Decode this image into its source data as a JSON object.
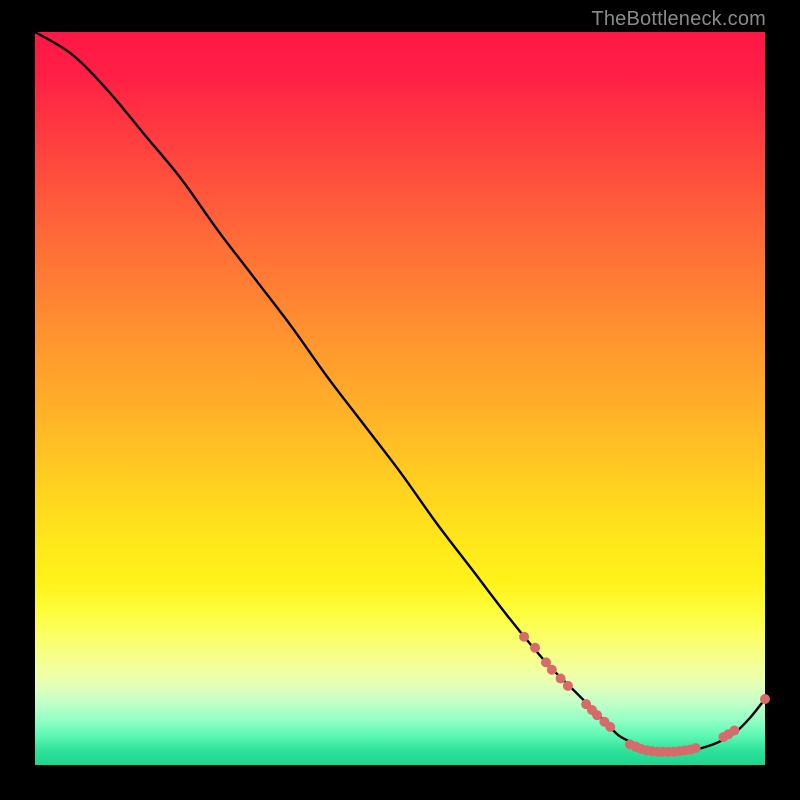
{
  "watermark": "TheBottleneck.com",
  "colors": {
    "marker": "#d76a6a",
    "curve": "#000000"
  },
  "chart_data": {
    "type": "line",
    "title": "",
    "xlabel": "",
    "ylabel": "",
    "xlim": [
      0,
      100
    ],
    "ylim": [
      0,
      100
    ],
    "note": "Values are normalized percentages. X is position across plot (left→right), Y is height (0 at bottom of colored area, 100 at top). Curve starts at top-left, descends diagonally, bottoms out near x≈84, then rises toward the right.",
    "series": [
      {
        "name": "bottleneck-curve",
        "x": [
          0,
          5,
          10,
          15,
          20,
          25,
          30,
          35,
          40,
          45,
          50,
          55,
          60,
          65,
          70,
          74,
          78,
          80,
          82,
          84,
          86,
          88,
          90,
          92,
          94,
          96,
          98,
          100
        ],
        "y": [
          100,
          97,
          92,
          86,
          80,
          73,
          66.5,
          60,
          53,
          46.5,
          40,
          33,
          26.5,
          20,
          14,
          10,
          6,
          4,
          3,
          2.2,
          1.8,
          1.8,
          2,
          2.5,
          3.3,
          4.5,
          6.5,
          9
        ]
      }
    ],
    "markers": {
      "name": "highlighted-points",
      "color": "#d76a6a",
      "radius": 5,
      "points": [
        {
          "x": 67,
          "y": 17.5
        },
        {
          "x": 68.5,
          "y": 16
        },
        {
          "x": 70,
          "y": 14
        },
        {
          "x": 70.8,
          "y": 13
        },
        {
          "x": 72,
          "y": 11.8
        },
        {
          "x": 73,
          "y": 10.8
        },
        {
          "x": 75.5,
          "y": 8.3
        },
        {
          "x": 76.3,
          "y": 7.5
        },
        {
          "x": 77,
          "y": 6.8
        },
        {
          "x": 78,
          "y": 5.9
        },
        {
          "x": 78.8,
          "y": 5.2
        },
        {
          "x": 81.5,
          "y": 2.8
        },
        {
          "x": 82.3,
          "y": 2.5
        },
        {
          "x": 83,
          "y": 2.2
        },
        {
          "x": 83.8,
          "y": 2.0
        },
        {
          "x": 84.5,
          "y": 1.9
        },
        {
          "x": 85.3,
          "y": 1.8
        },
        {
          "x": 86,
          "y": 1.8
        },
        {
          "x": 86.8,
          "y": 1.8
        },
        {
          "x": 87.5,
          "y": 1.8
        },
        {
          "x": 88.3,
          "y": 1.9
        },
        {
          "x": 89,
          "y": 2.0
        },
        {
          "x": 89.8,
          "y": 2.1
        },
        {
          "x": 90.5,
          "y": 2.3
        },
        {
          "x": 94.3,
          "y": 3.8
        },
        {
          "x": 95,
          "y": 4.2
        },
        {
          "x": 95.8,
          "y": 4.7
        },
        {
          "x": 100,
          "y": 9
        }
      ]
    }
  }
}
